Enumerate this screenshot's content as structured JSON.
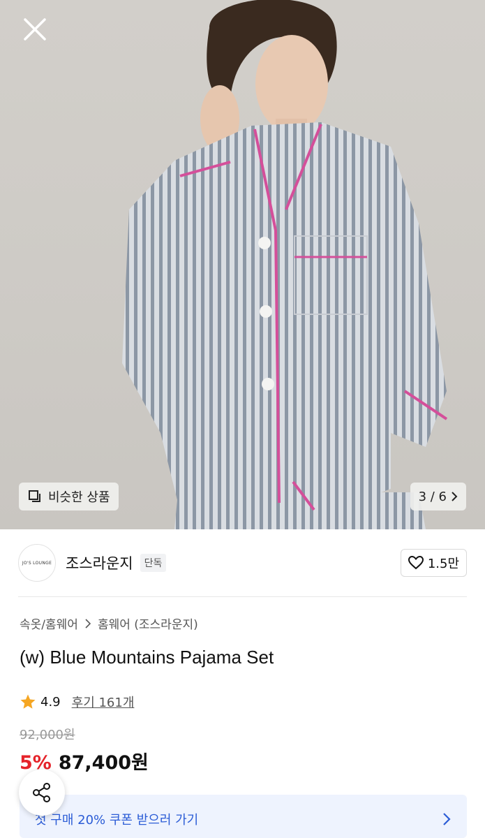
{
  "gallery": {
    "similar_label": "비슷한 상품",
    "counter": "3 / 6"
  },
  "brand": {
    "logo_text": "JO'S LOUNGE",
    "name": "조스라운지",
    "badge": "단독",
    "likes": "1.5만"
  },
  "product": {
    "breadcrumb": [
      "속옷/홈웨어",
      "홈웨어 (조스라운지)"
    ],
    "title": "(w) Blue Mountains Pajama Set",
    "rating": "4.9",
    "reviews_label": "후기 161개",
    "original_price": "92,000원",
    "discount": "5%",
    "price": "87,400원"
  },
  "coupon": {
    "text": "첫 구매 20% 쿠폰 받으러 가기"
  },
  "colors": {
    "accent_red": "#e5232a",
    "star": "#f5a623",
    "coupon_blue": "#2b5cd6"
  }
}
